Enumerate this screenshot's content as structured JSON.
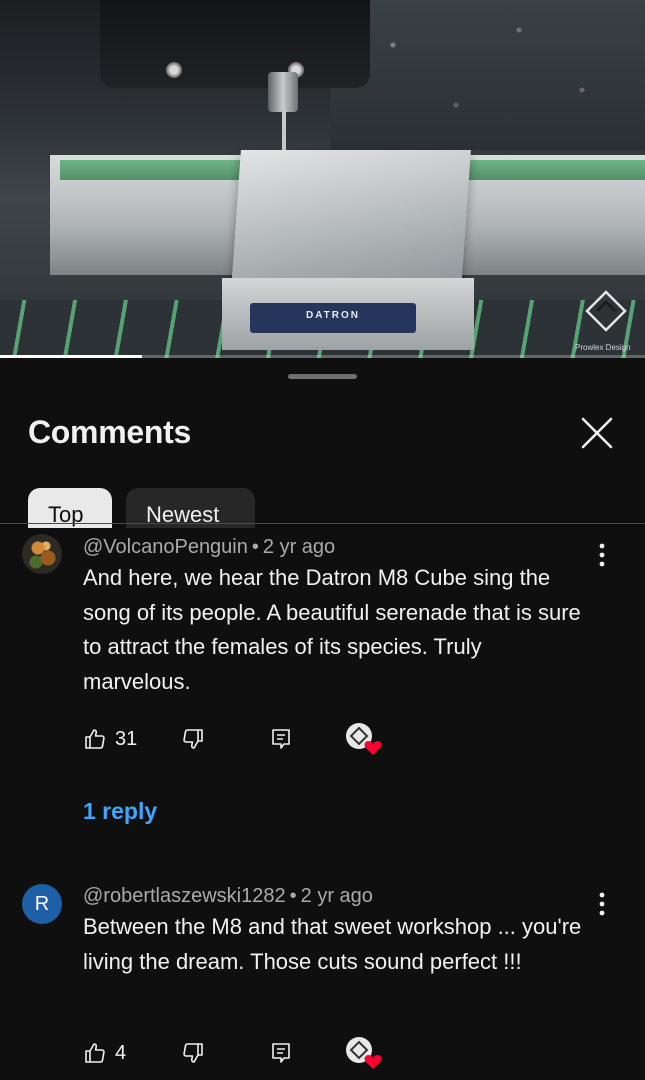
{
  "video": {
    "brand_plate": "DATRON",
    "watermark": "Prowlex Design",
    "progress": 0.22
  },
  "sheet": {
    "title": "Comments",
    "tabs": [
      {
        "label": "Top",
        "selected": true
      },
      {
        "label": "Newest",
        "selected": false
      }
    ]
  },
  "comments": [
    {
      "author": "@VolcanoPenguin",
      "time": "2 yr ago",
      "text": "And here, we hear the Datron M8 Cube sing the song of its people. A beautiful serenade that is sure to attract the females of its species. Truly marvelous.",
      "likes": "31",
      "avatar_icon": "user-avatar-image",
      "creator_heart": true,
      "reply_label": "1 reply"
    },
    {
      "author": "@robertlaszewski1282",
      "time": "2 yr ago",
      "text": "Between the M8 and that sweet workshop ... you're living the dream.  Those cuts sound perfect !!!",
      "likes": "4",
      "avatar_letter": "R",
      "avatar_color": "#1e5fa8",
      "creator_heart": true
    }
  ],
  "colors": {
    "background": "#0f0f0f",
    "link": "#3ea6ff",
    "heart": "#ff0033"
  }
}
